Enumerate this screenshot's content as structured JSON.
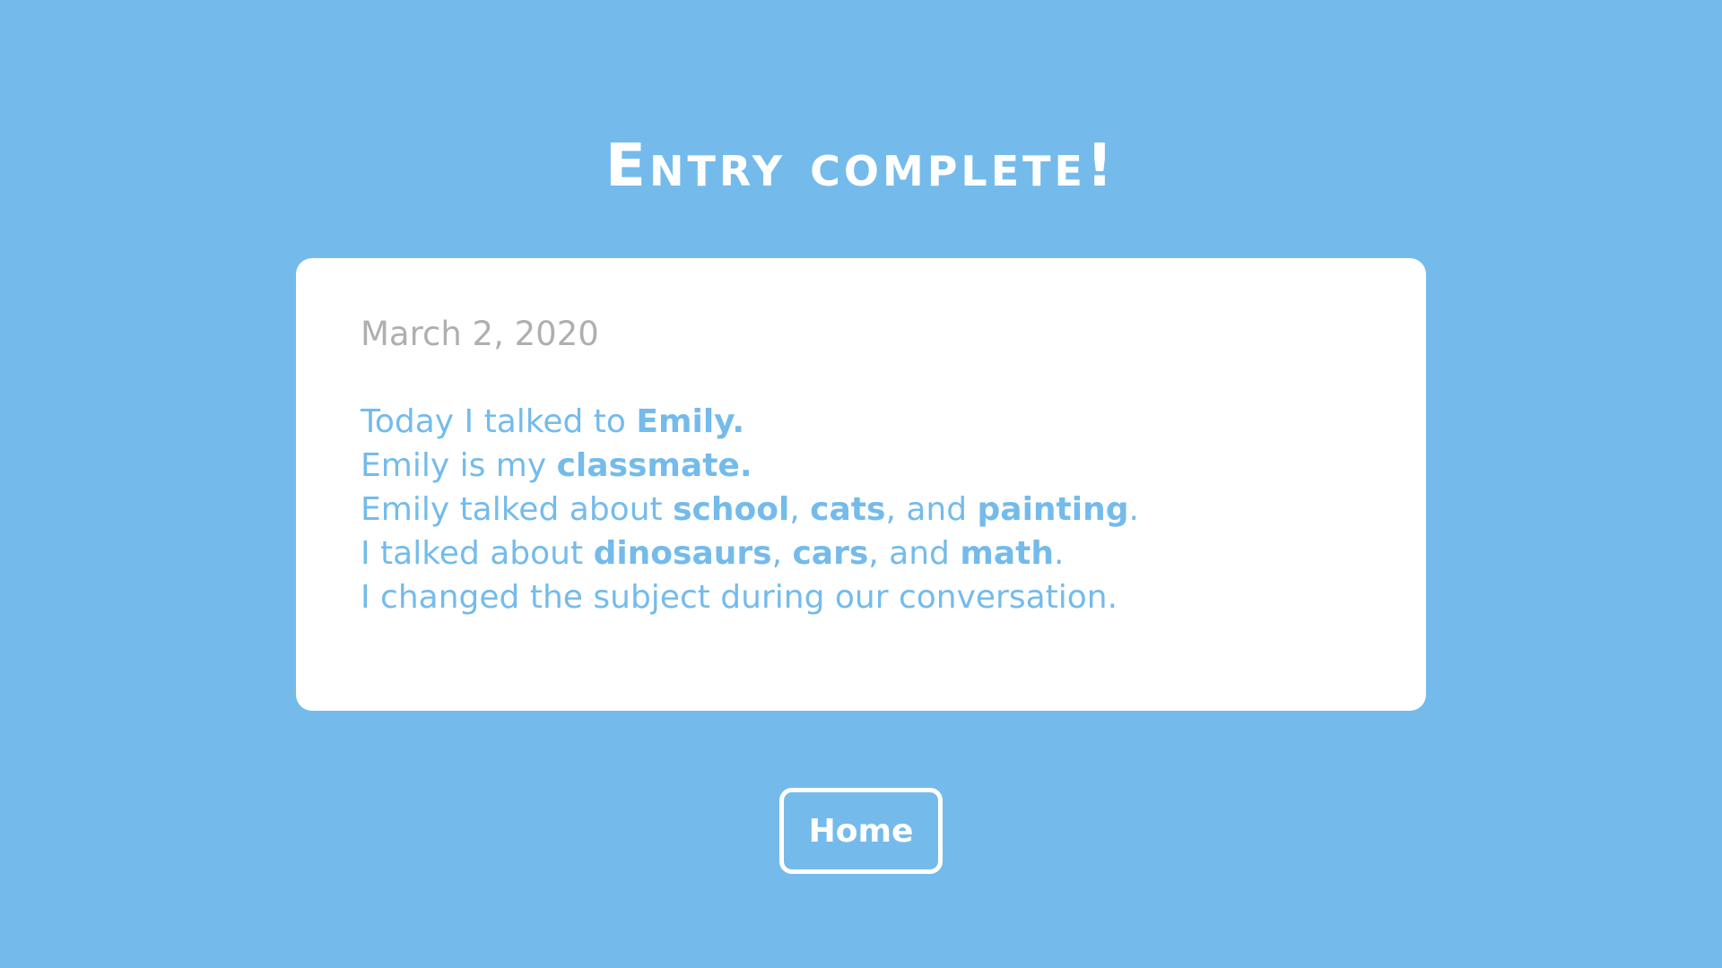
{
  "page": {
    "title": "Entry complete!",
    "background_color": "#74BBEB",
    "accent_color": "#74BBEB"
  },
  "entry": {
    "date": "March 2, 2020",
    "lines": [
      {
        "prefix": "Today I talked to ",
        "name": "Emily."
      },
      {
        "prefix": "Emily is my ",
        "relationship": "classmate."
      },
      {
        "prefix": "Emily talked about ",
        "topics": [
          "school",
          "cats",
          "painting"
        ],
        "sep1": ", ",
        "sep2": ", and ",
        "end": "."
      },
      {
        "prefix": "I talked about ",
        "topics": [
          "dinosaurs",
          "cars",
          "math"
        ],
        "sep1": ", ",
        "sep2": ", and ",
        "end": "."
      },
      {
        "text": "I changed the subject during our conversation."
      }
    ]
  },
  "buttons": {
    "home_label": "Home"
  }
}
